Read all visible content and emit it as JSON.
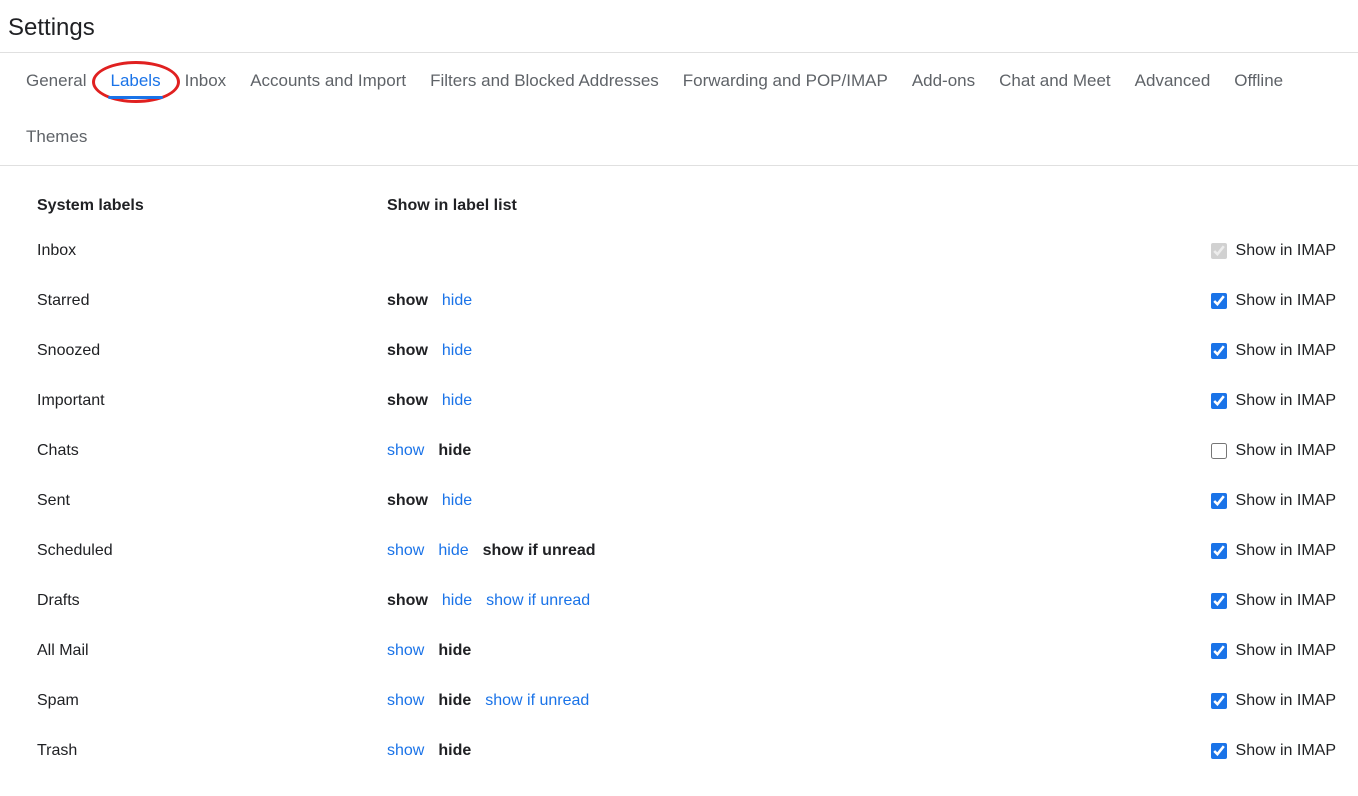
{
  "title": "Settings",
  "tabs": [
    {
      "label": "General",
      "active": false
    },
    {
      "label": "Labels",
      "active": true
    },
    {
      "label": "Inbox",
      "active": false
    },
    {
      "label": "Accounts and Import",
      "active": false
    },
    {
      "label": "Filters and Blocked Addresses",
      "active": false
    },
    {
      "label": "Forwarding and POP/IMAP",
      "active": false
    },
    {
      "label": "Add-ons",
      "active": false
    },
    {
      "label": "Chat and Meet",
      "active": false
    },
    {
      "label": "Advanced",
      "active": false
    },
    {
      "label": "Offline",
      "active": false
    },
    {
      "label": "Themes",
      "active": false
    }
  ],
  "headers": {
    "col1": "System labels",
    "col2": "Show in label list"
  },
  "imap_label": "Show in IMAP",
  "option_text": {
    "show": "show",
    "hide": "hide",
    "show_if_unread": "show if unread"
  },
  "rows": [
    {
      "name": "Inbox",
      "options": [],
      "imap_checked": true,
      "imap_disabled": true
    },
    {
      "name": "Starred",
      "options": [
        "show",
        "hide"
      ],
      "selected": "show",
      "imap_checked": true,
      "imap_disabled": false
    },
    {
      "name": "Snoozed",
      "options": [
        "show",
        "hide"
      ],
      "selected": "show",
      "imap_checked": true,
      "imap_disabled": false
    },
    {
      "name": "Important",
      "options": [
        "show",
        "hide"
      ],
      "selected": "show",
      "imap_checked": true,
      "imap_disabled": false
    },
    {
      "name": "Chats",
      "options": [
        "show",
        "hide"
      ],
      "selected": "hide",
      "imap_checked": false,
      "imap_disabled": false
    },
    {
      "name": "Sent",
      "options": [
        "show",
        "hide"
      ],
      "selected": "show",
      "imap_checked": true,
      "imap_disabled": false
    },
    {
      "name": "Scheduled",
      "options": [
        "show",
        "hide",
        "show_if_unread"
      ],
      "selected": "show_if_unread",
      "imap_checked": true,
      "imap_disabled": false
    },
    {
      "name": "Drafts",
      "options": [
        "show",
        "hide",
        "show_if_unread"
      ],
      "selected": "show",
      "imap_checked": true,
      "imap_disabled": false
    },
    {
      "name": "All Mail",
      "options": [
        "show",
        "hide"
      ],
      "selected": "hide",
      "imap_checked": true,
      "imap_disabled": false
    },
    {
      "name": "Spam",
      "options": [
        "show",
        "hide",
        "show_if_unread"
      ],
      "selected": "hide",
      "imap_checked": true,
      "imap_disabled": false
    },
    {
      "name": "Trash",
      "options": [
        "show",
        "hide"
      ],
      "selected": "hide",
      "imap_checked": true,
      "imap_disabled": false
    }
  ]
}
